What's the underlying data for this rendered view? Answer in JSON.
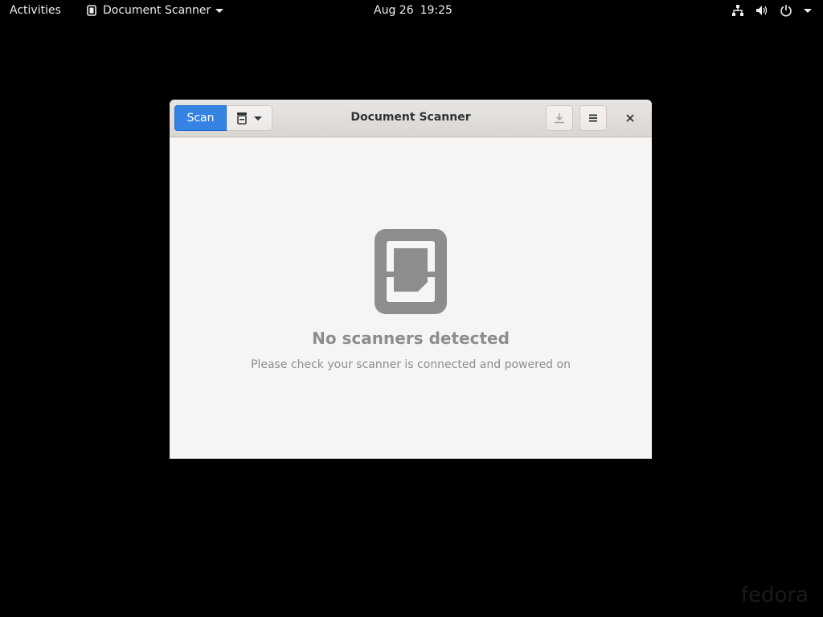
{
  "topbar": {
    "activities": "Activities",
    "app_name": "Document Scanner",
    "date": "Aug 26",
    "time": "19:25",
    "icons": [
      "network-icon",
      "volume-icon",
      "power-icon",
      "chevron-down-icon"
    ]
  },
  "window": {
    "title": "Document Scanner",
    "scan_label": "Scan",
    "scan_type_icon": "scanner-icon",
    "save_icon": "download-icon",
    "menu_icon": "hamburger-menu-icon",
    "close_icon": "close-icon",
    "accent_color": "#3584e4"
  },
  "status": {
    "title": "No scanners detected",
    "description": "Please check your scanner is connected and powered on",
    "icon": "scanner-document-icon"
  },
  "watermark": "fedora"
}
